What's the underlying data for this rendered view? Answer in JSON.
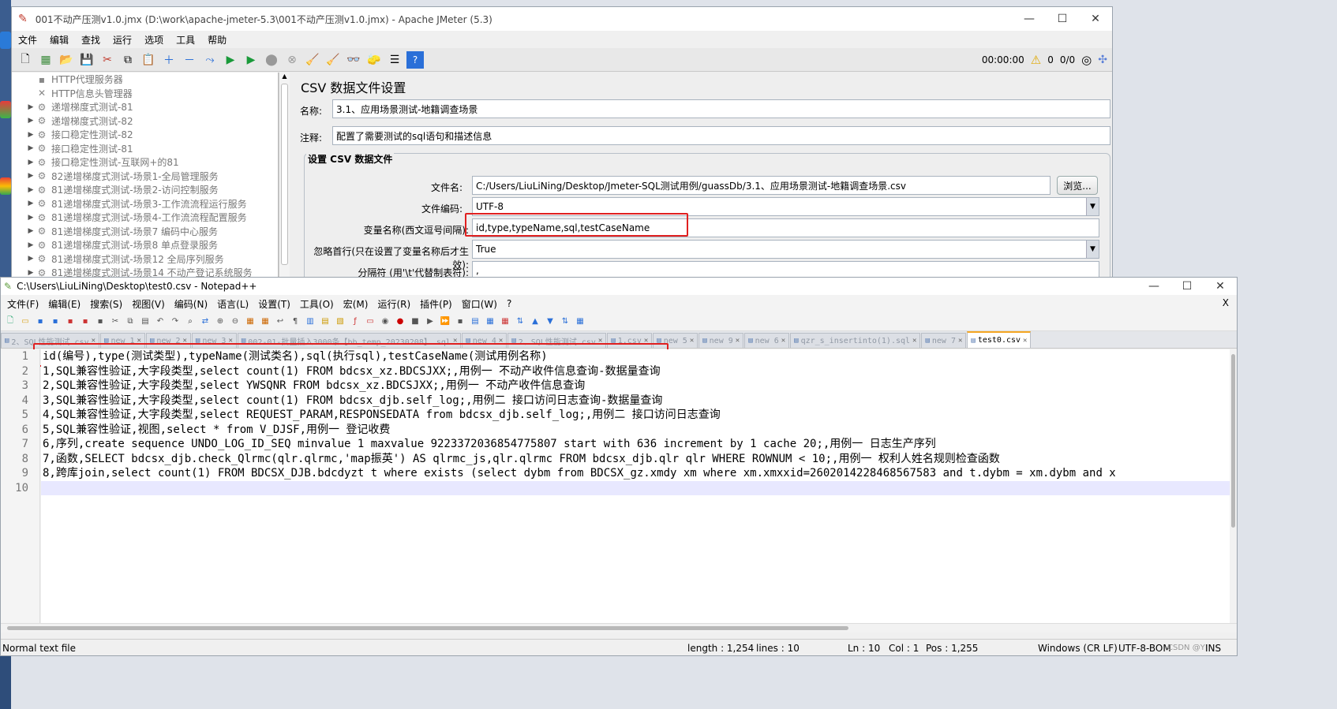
{
  "jmeter": {
    "title": "001不动产压测v1.0.jmx (D:\\work\\apache-jmeter-5.3\\001不动产压测v1.0.jmx) - Apache JMeter (5.3)",
    "menu": [
      "文件",
      "编辑",
      "查找",
      "运行",
      "选项",
      "工具",
      "帮助"
    ],
    "status": {
      "timer": "00:00:00",
      "warnings": "0",
      "threads": "0/0"
    },
    "tree_items": [
      {
        "label": "HTTP代理服务器",
        "icon": "proxy-icon",
        "arrow": false
      },
      {
        "label": "HTTP信息头管理器",
        "icon": "tools-icon",
        "arrow": false
      },
      {
        "label": "递增梯度式测试-81",
        "icon": "gear-icon",
        "arrow": true
      },
      {
        "label": "递增梯度式测试-82",
        "icon": "gear-icon",
        "arrow": true
      },
      {
        "label": "接口稳定性测试-82",
        "icon": "gear-icon",
        "arrow": true
      },
      {
        "label": "接口稳定性测试-81",
        "icon": "gear-icon",
        "arrow": true
      },
      {
        "label": "接口稳定性测试-互联网+的81",
        "icon": "gear-icon",
        "arrow": true
      },
      {
        "label": "82递增梯度式测试-场景1-全局管理服务",
        "icon": "gear-icon",
        "arrow": true
      },
      {
        "label": "81递增梯度式测试-场景2-访问控制服务",
        "icon": "gear-icon",
        "arrow": true
      },
      {
        "label": "81递增梯度式测试-场景3-工作流流程运行服务",
        "icon": "gear-icon",
        "arrow": true
      },
      {
        "label": "81递增梯度式测试-场景4-工作流流程配置服务",
        "icon": "gear-icon",
        "arrow": true
      },
      {
        "label": "81递增梯度式测试-场景7 编码中心服务",
        "icon": "gear-icon",
        "arrow": true
      },
      {
        "label": "81递增梯度式测试-场景8 单点登录服务",
        "icon": "gear-icon",
        "arrow": true
      },
      {
        "label": "81递增梯度式测试-场景12 全局序列服务",
        "icon": "gear-icon",
        "arrow": true
      },
      {
        "label": "81递增梯度式测试-场景14 不动产登记系统服务",
        "icon": "gear-icon",
        "arrow": true
      }
    ],
    "panel": {
      "heading": "CSV 数据文件设置",
      "name_label": "名称:",
      "name_value": "3.1、应用场景测试-地籍调查场景",
      "comment_label": "注释:",
      "comment_value": "配置了需要测试的sql语句和描述信息",
      "section_title": "设置 CSV 数据文件",
      "filename_label": "文件名:",
      "filename_value": "C:/Users/LiuLiNing/Desktop/Jmeter-SQL测试用例/guassDb/3.1、应用场景测试-地籍调查场景.csv",
      "browse_label": "浏览...",
      "encoding_label": "文件编码:",
      "encoding_value": "UTF-8",
      "varnames_label": "变量名称(西文逗号间隔):",
      "varnames_value": "id,type,typeName,sql,testCaseName",
      "ignore_label": "忽略首行(只在设置了变量名称后才生效):",
      "ignore_value": "True",
      "delimiter_label": "分隔符 (用'\\t'代替制表符):",
      "delimiter_value": ","
    }
  },
  "notepad": {
    "title": "C:\\Users\\LiuLiNing\\Desktop\\test0.csv - Notepad++",
    "menu": [
      "文件(F)",
      "编辑(E)",
      "搜索(S)",
      "视图(V)",
      "编码(N)",
      "语言(L)",
      "设置(T)",
      "工具(O)",
      "宏(M)",
      "运行(R)",
      "插件(P)",
      "窗口(W)",
      "?"
    ],
    "tabs": [
      {
        "label": "2、SQL性能测试.csv",
        "active": false
      },
      {
        "label": "new 1",
        "active": false
      },
      {
        "label": "new 2",
        "active": false
      },
      {
        "label": "new 3",
        "active": false
      },
      {
        "label": "002-01-批量插入3000条【bb_temp_20230208】.sql",
        "active": false
      },
      {
        "label": "new 4",
        "active": false
      },
      {
        "label": "2、SQL性能测试.csv",
        "active": false
      },
      {
        "label": "1.csv",
        "active": false
      },
      {
        "label": "new 5",
        "active": false
      },
      {
        "label": "new 9",
        "active": false
      },
      {
        "label": "new 6",
        "active": false
      },
      {
        "label": "qzr_s_insertinto(1).sql",
        "active": false
      },
      {
        "label": "new 7",
        "active": false
      },
      {
        "label": "test0.csv",
        "active": true
      }
    ],
    "lines": [
      "id(编号),type(测试类型),typeName(测试类名),sql(执行sql),testCaseName(测试用例名称)",
      "1,SQL兼容性验证,大字段类型,select count(1) FROM bdcsx_xz.BDCSJXX;,用例一 不动产收件信息查询-数据量查询",
      "2,SQL兼容性验证,大字段类型,select YWSQNR FROM bdcsx_xz.BDCSJXX;,用例一 不动产收件信息查询",
      "3,SQL兼容性验证,大字段类型,select count(1) FROM bdcsx_djb.self_log;,用例二 接口访问日志查询-数据量查询",
      "4,SQL兼容性验证,大字段类型,select REQUEST_PARAM,RESPONSEDATA from bdcsx_djb.self_log;,用例二 接口访问日志查询",
      "5,SQL兼容性验证,视图,select * from V_DJSF,用例一 登记收费",
      "6,序列,create sequence UNDO_LOG_ID_SEQ minvalue 1 maxvalue 9223372036854775807 start with 636 increment by 1 cache 20;,用例一 日志生产序列",
      "7,函数,SELECT bdcsx_djb.check_Qlrmc(qlr.qlrmc,'map振英') AS qlrmc_js,qlr.qlrmc FROM bdcsx_djb.qlr qlr WHERE ROWNUM < 10;,用例一 权利人姓名规则检查函数",
      "8,跨库join,select count(1) FROM BDCSX_DJB.bdcdyzt t where exists (select dybm from BDCSX_gz.xmdy xm where xm.xmxxid=2602014228468567583 and t.dybm = xm.dybm and x",
      ""
    ],
    "line_numbers": [
      "1",
      "2",
      "3",
      "4",
      "5",
      "6",
      "7",
      "8",
      "9",
      "10"
    ],
    "status": {
      "type": "Normal text file",
      "length": "length : 1,254",
      "lines": "lines : 10",
      "ln": "Ln : 10",
      "col": "Col : 1",
      "pos": "Pos : 1,255",
      "eol": "Windows (CR LF)",
      "encoding": "UTF-8-BOM",
      "watermark": "CSDN @Y",
      "mode": "INS"
    }
  }
}
